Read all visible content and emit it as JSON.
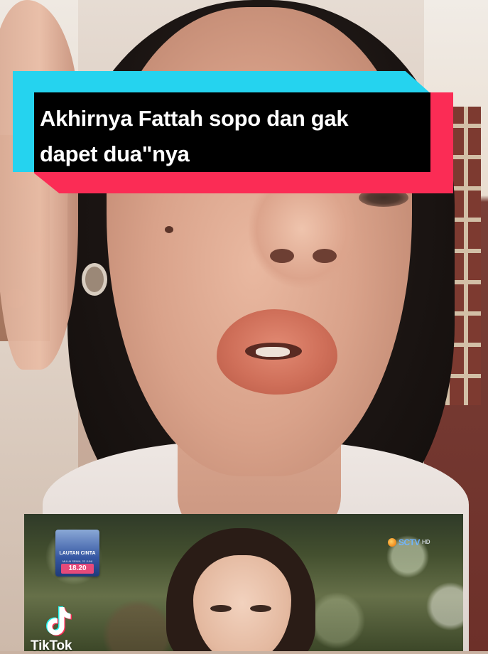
{
  "caption": {
    "text": "Akhirnya Fattah sopo dan gak\ndapet dua\"nya"
  },
  "embedded_clip": {
    "promo": {
      "title": "LAUTAN CINTA",
      "subtitle": "MULAI SENIN, 22 JUNI",
      "time": "18.20"
    },
    "channel": {
      "name": "SCTV",
      "quality": "HD"
    }
  },
  "watermark": {
    "brand": "TikTok"
  },
  "colors": {
    "caption_cyan": "#25d3ef",
    "caption_red": "#fb2c55",
    "caption_bg": "#000000",
    "caption_text": "#ffffff"
  }
}
